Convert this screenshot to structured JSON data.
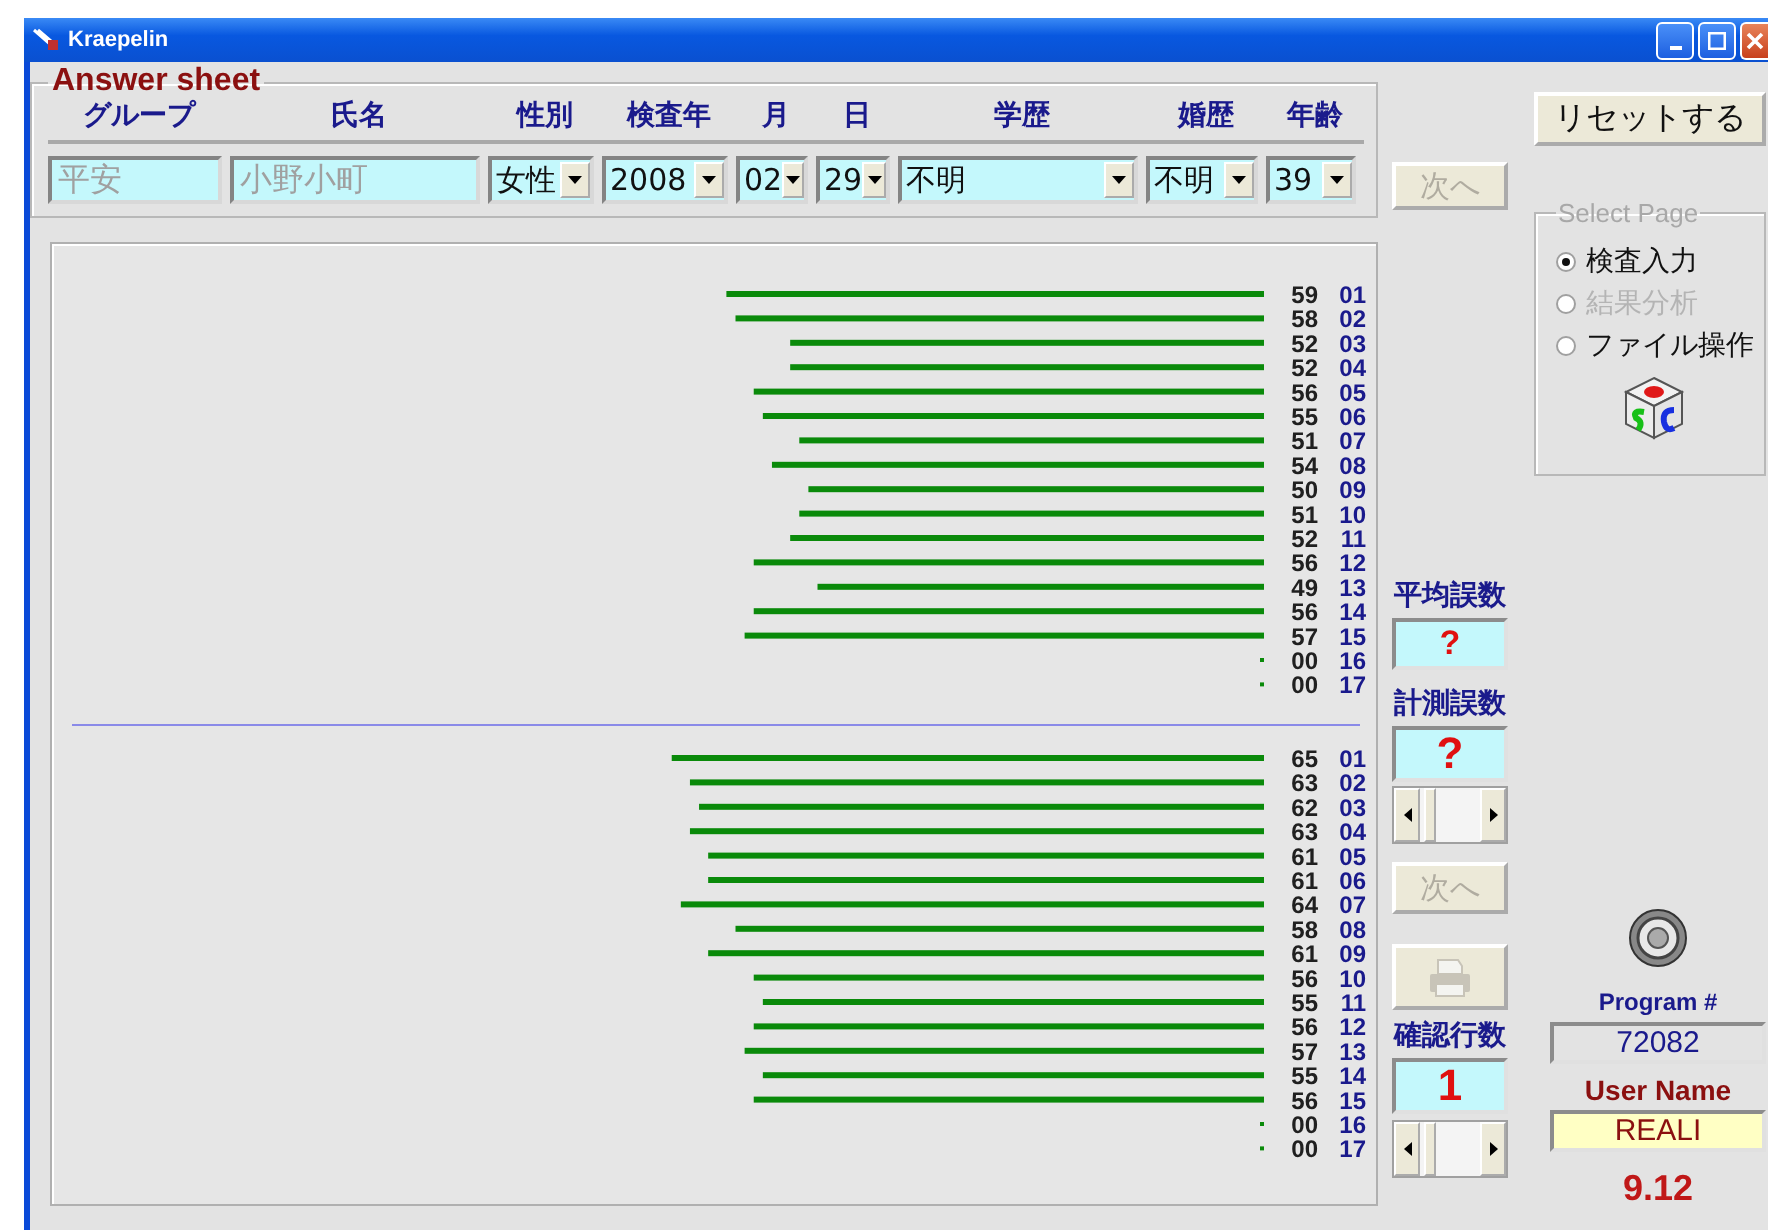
{
  "window": {
    "title": "Kraepelin"
  },
  "answer_sheet": {
    "title": "Answer sheet",
    "fields": [
      {
        "label": "グループ",
        "kind": "text",
        "value": "平安",
        "disabled": true
      },
      {
        "label": "氏名",
        "kind": "text",
        "value": "小野小町",
        "disabled": true
      },
      {
        "label": "性別",
        "kind": "combo",
        "value": "女性",
        "disabled": false
      },
      {
        "label": "検査年",
        "kind": "combo",
        "value": "2008",
        "disabled": false
      },
      {
        "label": "月",
        "kind": "combo",
        "value": "02",
        "disabled": false
      },
      {
        "label": "日",
        "kind": "combo",
        "value": "29",
        "disabled": false
      },
      {
        "label": "学歴",
        "kind": "combo",
        "value": "不明",
        "disabled": false
      },
      {
        "label": "婚歴",
        "kind": "combo",
        "value": "不明",
        "disabled": false
      },
      {
        "label": "年齢",
        "kind": "combo",
        "value": "39",
        "disabled": false
      }
    ]
  },
  "next_button": {
    "label": "次へ",
    "disabled": true
  },
  "answer_panel": {
    "charts": [
      {
        "chart_data": {
          "type": "bar",
          "orientation": "horizontal",
          "categories": [
            "01",
            "02",
            "03",
            "04",
            "05",
            "06",
            "07",
            "08",
            "09",
            "10",
            "11",
            "12",
            "13",
            "14",
            "15",
            "16",
            "17"
          ],
          "values": [
            59,
            58,
            52,
            52,
            56,
            55,
            51,
            54,
            50,
            51,
            52,
            56,
            49,
            56,
            57,
            0,
            0
          ],
          "value_labels": [
            "59",
            "58",
            "52",
            "52",
            "56",
            "55",
            "51",
            "54",
            "50",
            "51",
            "52",
            "56",
            "49",
            "56",
            "57",
            "00",
            "00"
          ]
        }
      },
      {
        "chart_data": {
          "type": "bar",
          "orientation": "horizontal",
          "categories": [
            "01",
            "02",
            "03",
            "04",
            "05",
            "06",
            "07",
            "08",
            "09",
            "10",
            "11",
            "12",
            "13",
            "14",
            "15",
            "16",
            "17"
          ],
          "values": [
            65,
            63,
            62,
            63,
            61,
            61,
            64,
            58,
            61,
            56,
            55,
            56,
            57,
            55,
            56,
            0,
            0
          ],
          "value_labels": [
            "65",
            "63",
            "62",
            "63",
            "61",
            "61",
            "64",
            "58",
            "61",
            "56",
            "55",
            "56",
            "57",
            "55",
            "56",
            "00",
            "00"
          ]
        }
      }
    ]
  },
  "side_panel": {
    "average_errors": {
      "label": "平均誤数",
      "value": "?"
    },
    "measured_errors": {
      "label": "計測誤数",
      "value": "?"
    },
    "next_button": {
      "label": "次へ",
      "disabled": true
    },
    "print_button": {
      "disabled": true
    },
    "check_rows": {
      "label": "確認行数",
      "value": "1"
    }
  },
  "reset_button": {
    "label": "リセットする"
  },
  "select_page": {
    "title": "Select  Page",
    "options": [
      {
        "label": "検査入力",
        "selected": true,
        "disabled": false
      },
      {
        "label": "結果分析",
        "selected": false,
        "disabled": true
      },
      {
        "label": "ファイル操作",
        "selected": false,
        "disabled": false
      }
    ]
  },
  "program": {
    "label": "Program #",
    "value": "72082"
  },
  "user": {
    "label": "User Name",
    "value": "REALI"
  },
  "version": "9.12"
}
